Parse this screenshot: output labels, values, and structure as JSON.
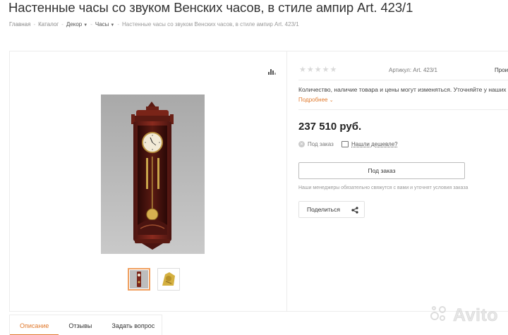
{
  "product": {
    "title": "Настенные часы со звуком Венских часов, в стиле ампир Art. 423/1"
  },
  "breadcrumb": {
    "home": "Главная",
    "catalog": "Каталог",
    "decor": "Декор",
    "clocks": "Часы",
    "current": "Настенные часы со звуком Венских часов, в стиле ампир Art. 423/1"
  },
  "info": {
    "sku": "Артикул: Art. 423/1",
    "producer": "Прои",
    "note": "Количество, наличие товара и цены могут изменяться. Уточняйте у наших",
    "more_label": "Подробнее",
    "price": "237 510 руб.",
    "status": "Под заказ",
    "cheaper": "Нашли дешевле?",
    "order_button": "Под заказ",
    "manager_note": "Наши менеджеры обязательно свяжутся с вами и уточнят условия заказа",
    "share_button": "Поделиться",
    "rating": 0,
    "rating_max": 5
  },
  "tabs": [
    {
      "label": "Описание"
    },
    {
      "label": "Отзывы"
    },
    {
      "label": "Задать вопрос"
    }
  ],
  "watermark": {
    "text": "Avito"
  },
  "colors": {
    "accent": "#e07a2e",
    "star_inactive": "#d9d9d9"
  },
  "icons": [
    "stats-icon",
    "star-icon",
    "status-icon",
    "price-tag-icon",
    "share-icon",
    "chevron-down-icon"
  ]
}
